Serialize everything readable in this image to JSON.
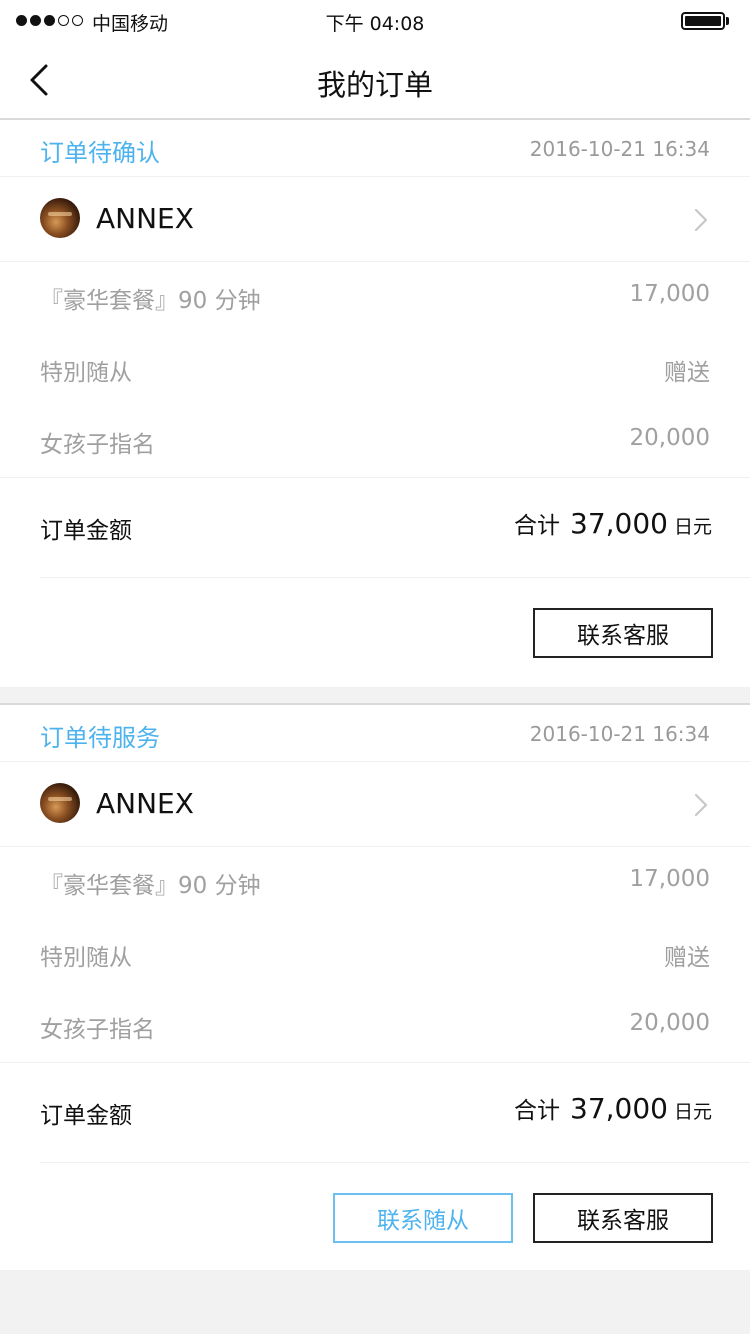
{
  "status_bar": {
    "carrier": "中国移动",
    "time": "下午 04:08",
    "signal_dots_filled": 3,
    "signal_dots_total": 5
  },
  "nav": {
    "title": "我的订单",
    "back_icon": "chevron-left-icon"
  },
  "orders": [
    {
      "status": "订单待确认",
      "datetime": "2016-10-21 16:34",
      "shop_name": "ANNEX",
      "items": [
        {
          "label": "『豪华套餐』90 分钟",
          "value": "17,000"
        },
        {
          "label": "特別随从",
          "value": "赠送"
        },
        {
          "label": "女孩子指名",
          "value": "20,000"
        }
      ],
      "total_label": "订单金额",
      "total_prefix": "合计",
      "total_amount": "37,000",
      "total_unit": "日元",
      "buttons": {
        "service": "联系客服"
      }
    },
    {
      "status": "订单待服务",
      "datetime": "2016-10-21 16:34",
      "shop_name": "ANNEX",
      "items": [
        {
          "label": "『豪华套餐』90 分钟",
          "value": "17,000"
        },
        {
          "label": "特別随从",
          "value": "赠送"
        },
        {
          "label": "女孩子指名",
          "value": "20,000"
        }
      ],
      "total_label": "订单金额",
      "total_prefix": "合计",
      "total_amount": "37,000",
      "total_unit": "日元",
      "buttons": {
        "escort": "联系随从",
        "service": "联系客服"
      }
    }
  ],
  "colors": {
    "accent": "#4db3ee",
    "muted_text": "#a0a0a0",
    "background": "#f2f2f2"
  }
}
